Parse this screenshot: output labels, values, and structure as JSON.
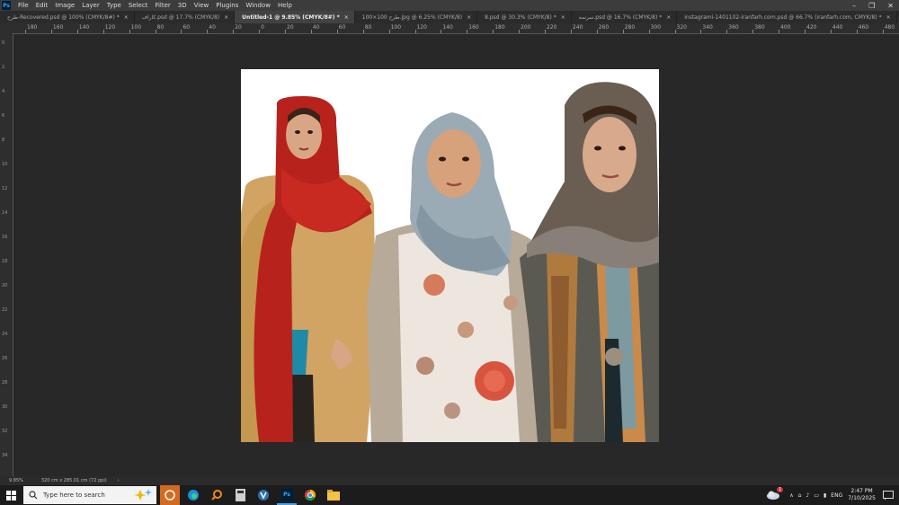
{
  "app": {
    "logo": "Ps",
    "menu": [
      "File",
      "Edit",
      "Image",
      "Layer",
      "Type",
      "Select",
      "Filter",
      "3D",
      "View",
      "Plugins",
      "Window",
      "Help"
    ],
    "window_controls": [
      "–",
      "❐",
      "✕"
    ]
  },
  "tabs": [
    {
      "label": "طرح-Recovered.psd @ 100% (CMYK/8#) *"
    },
    {
      "label": "کاراف.psd @ 17.7% (CMYK/8)"
    },
    {
      "label": "Untitled-1 @ 9.85% (CMYK/8#) *",
      "active": true
    },
    {
      "label": "100×100 طرح.jpg @ 6.25% (CMYK/8)"
    },
    {
      "label": "8.psd @ 30.3% (CMYK/8) *"
    },
    {
      "label": "سرسه.psd @ 16.7% (CMYK/8) *"
    },
    {
      "label": "instagrami-1401102-iranfarh.com.psd @ 66.7% (iranfarh.com, CMYK/8) *"
    }
  ],
  "tab_close": "×",
  "ruler_top_labels": [
    "180",
    "160",
    "140",
    "120",
    "100",
    "80",
    "60",
    "40",
    "20",
    "0",
    "20",
    "40",
    "60",
    "80",
    "100",
    "120",
    "140",
    "160",
    "180",
    "200",
    "220",
    "240",
    "260",
    "280",
    "300",
    "320",
    "340",
    "360",
    "380",
    "400",
    "420",
    "440",
    "460",
    "480"
  ],
  "ruler_left_labels": [
    "0",
    "2",
    "4",
    "6",
    "8",
    "10",
    "12",
    "14",
    "16",
    "18",
    "20",
    "22",
    "24",
    "26",
    "28",
    "30",
    "32",
    "34"
  ],
  "status": {
    "zoom": "9.85%",
    "doc_size": "320 cm x 285.01 cm (72 ppi)",
    "arrow": "›"
  },
  "taskbar": {
    "search_placeholder": "Type here to search",
    "language": "ENG",
    "time": "2:47 PM",
    "date": "7/10/2025",
    "weather_badge": "1"
  },
  "colors": {
    "menubar": "#3c3c3c",
    "tabbar": "#2b2b2b",
    "workspace": "#282828",
    "taskbar": "#1c1c1c",
    "photoshop_blue": "#31a8ff"
  }
}
